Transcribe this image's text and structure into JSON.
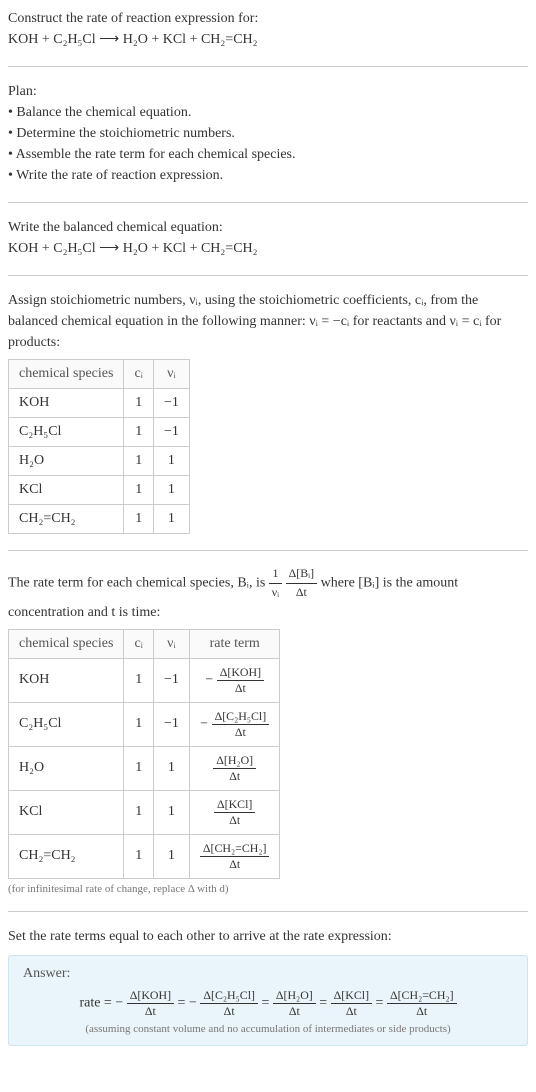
{
  "prompt": {
    "line1": "Construct the rate of reaction expression for:",
    "equation": "KOH + C₂H₅Cl  ⟶  H₂O + KCl + CH₂=CH₂"
  },
  "plan": {
    "heading": "Plan:",
    "items": [
      "• Balance the chemical equation.",
      "• Determine the stoichiometric numbers.",
      "• Assemble the rate term for each chemical species.",
      "• Write the rate of reaction expression."
    ]
  },
  "balanced": {
    "intro": "Write the balanced chemical equation:",
    "equation": "KOH + C₂H₅Cl  ⟶  H₂O + KCl + CH₂=CH₂"
  },
  "stoich_intro_a": "Assign stoichiometric numbers, νᵢ, using the stoichiometric coefficients, cᵢ, from the balanced chemical equation in the following manner: νᵢ = −cᵢ for reactants and νᵢ = cᵢ for products:",
  "stoich_table": {
    "headers": [
      "chemical species",
      "cᵢ",
      "νᵢ"
    ],
    "rows": [
      {
        "species": "KOH",
        "c": "1",
        "v": "−1"
      },
      {
        "species": "C₂H₅Cl",
        "c": "1",
        "v": "−1"
      },
      {
        "species": "H₂O",
        "c": "1",
        "v": "1"
      },
      {
        "species": "KCl",
        "c": "1",
        "v": "1"
      },
      {
        "species": "CH₂=CH₂",
        "c": "1",
        "v": "1"
      }
    ]
  },
  "rateterm_intro_a": "The rate term for each chemical species, Bᵢ, is ",
  "rateterm_frac1_num": "1",
  "rateterm_frac1_den": "νᵢ",
  "rateterm_frac2_num": "Δ[Bᵢ]",
  "rateterm_frac2_den": "Δt",
  "rateterm_intro_b": " where [Bᵢ] is the amount concentration and t is time:",
  "rate_table": {
    "headers": [
      "chemical species",
      "cᵢ",
      "νᵢ",
      "rate term"
    ],
    "rows": [
      {
        "species": "KOH",
        "c": "1",
        "v": "−1",
        "rt_sign": "−",
        "rt_num": "Δ[KOH]",
        "rt_den": "Δt"
      },
      {
        "species": "C₂H₅Cl",
        "c": "1",
        "v": "−1",
        "rt_sign": "−",
        "rt_num": "Δ[C₂H₅Cl]",
        "rt_den": "Δt"
      },
      {
        "species": "H₂O",
        "c": "1",
        "v": "1",
        "rt_sign": "",
        "rt_num": "Δ[H₂O]",
        "rt_den": "Δt"
      },
      {
        "species": "KCl",
        "c": "1",
        "v": "1",
        "rt_sign": "",
        "rt_num": "Δ[KCl]",
        "rt_den": "Δt"
      },
      {
        "species": "CH₂=CH₂",
        "c": "1",
        "v": "1",
        "rt_sign": "",
        "rt_num": "Δ[CH₂=CH₂]",
        "rt_den": "Δt"
      }
    ]
  },
  "infinitesimal_note": "(for infinitesimal rate of change, replace Δ with d)",
  "final_intro": "Set the rate terms equal to each other to arrive at the rate expression:",
  "answer": {
    "label": "Answer:",
    "prefix": "rate = −",
    "terms": [
      {
        "num": "Δ[KOH]",
        "den": "Δt"
      },
      {
        "num": "Δ[C₂H₅Cl]",
        "den": "Δt"
      },
      {
        "num": "Δ[H₂O]",
        "den": "Δt"
      },
      {
        "num": "Δ[KCl]",
        "den": "Δt"
      },
      {
        "num": "Δ[CH₂=CH₂]",
        "den": "Δt"
      }
    ],
    "joins": [
      " = −",
      " = ",
      " = ",
      " = "
    ],
    "assumption": "(assuming constant volume and no accumulation of intermediates or side products)"
  },
  "chart_data": {
    "type": "table",
    "tables": [
      {
        "title": "Stoichiometric numbers",
        "columns": [
          "chemical species",
          "c_i",
          "v_i"
        ],
        "rows": [
          [
            "KOH",
            1,
            -1
          ],
          [
            "C2H5Cl",
            1,
            -1
          ],
          [
            "H2O",
            1,
            1
          ],
          [
            "KCl",
            1,
            1
          ],
          [
            "CH2=CH2",
            1,
            1
          ]
        ]
      },
      {
        "title": "Rate terms",
        "columns": [
          "chemical species",
          "c_i",
          "v_i",
          "rate term"
        ],
        "rows": [
          [
            "KOH",
            1,
            -1,
            "-Δ[KOH]/Δt"
          ],
          [
            "C2H5Cl",
            1,
            -1,
            "-Δ[C2H5Cl]/Δt"
          ],
          [
            "H2O",
            1,
            1,
            "Δ[H2O]/Δt"
          ],
          [
            "KCl",
            1,
            1,
            "Δ[KCl]/Δt"
          ],
          [
            "CH2=CH2",
            1,
            1,
            "Δ[CH2=CH2]/Δt"
          ]
        ]
      }
    ]
  }
}
